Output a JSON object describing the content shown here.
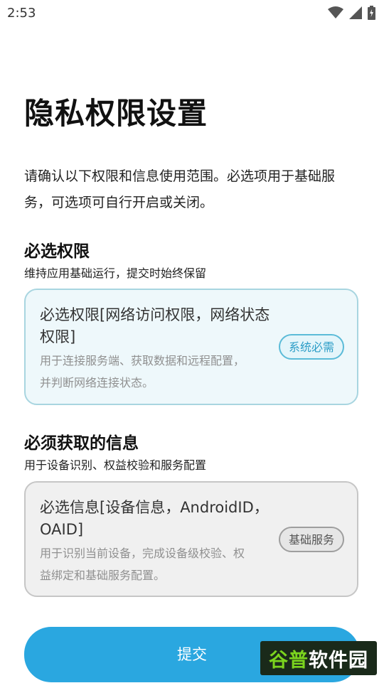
{
  "status_bar": {
    "time": "2:53"
  },
  "page": {
    "title": "隐私权限设置",
    "description": "请确认以下权限和信息使用范围。必选项用于基础服务，可选项可自行开启或关闭。"
  },
  "sections": {
    "permissions": {
      "title": "必选权限",
      "subtitle": "维持应用基础运行，提交时始终保留",
      "card": {
        "heading": "必选权限[网络访问权限，网络状态权限]",
        "note": "用于连接服务端、获取数据和远程配置，并判断网络连接状态。",
        "badge": "系统必需"
      }
    },
    "info": {
      "title": "必须获取的信息",
      "subtitle": "用于设备识别、权益校验和服务配置",
      "card": {
        "heading": "必选信息[设备信息，AndroidID，OAID]",
        "note": "用于识别当前设备，完成设备级校验、权益绑定和基础服务配置。",
        "badge": "基础服务"
      }
    }
  },
  "submit_label": "提交",
  "watermark": {
    "part1": "谷普",
    "part2": "软件园"
  },
  "colors": {
    "primary": "#2aa7e0",
    "badge_blue": "#2b9dc7",
    "card_blue_bg": "#eef8fb"
  }
}
